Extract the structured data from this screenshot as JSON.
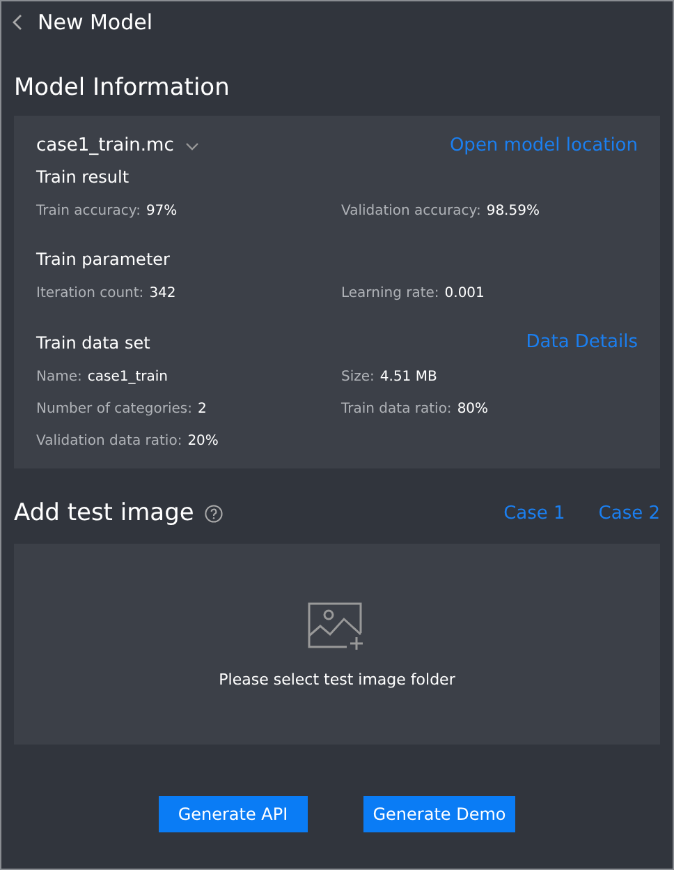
{
  "header": {
    "title": "New Model"
  },
  "model_info": {
    "heading": "Model Information",
    "file_name": "case1_train.mc",
    "open_link": "Open model location",
    "sections": [
      {
        "title": "Train result",
        "fields": [
          {
            "label": "Train accuracy:",
            "value": "97%"
          },
          {
            "label": "Validation accuracy:",
            "value": "98.59%"
          }
        ]
      },
      {
        "title": "Train parameter",
        "fields": [
          {
            "label": "Iteration count:",
            "value": "342"
          },
          {
            "label": "Learning rate:",
            "value": "0.001"
          }
        ]
      },
      {
        "title": "Train data set",
        "link": "Data Details",
        "fields": [
          {
            "label": "Name:",
            "value": "case1_train"
          },
          {
            "label": "Size:",
            "value": "4.51 MB"
          },
          {
            "label": "Number of categories:",
            "value": "2"
          },
          {
            "label": "Train data ratio:",
            "value": "80%"
          },
          {
            "label": "Validation data ratio:",
            "value": "20%"
          }
        ]
      }
    ]
  },
  "test_image": {
    "heading": "Add test image",
    "cases": [
      "Case 1",
      "Case 2"
    ],
    "drop_text": "Please select test image folder"
  },
  "buttons": [
    "Generate API",
    "Generate Demo"
  ]
}
